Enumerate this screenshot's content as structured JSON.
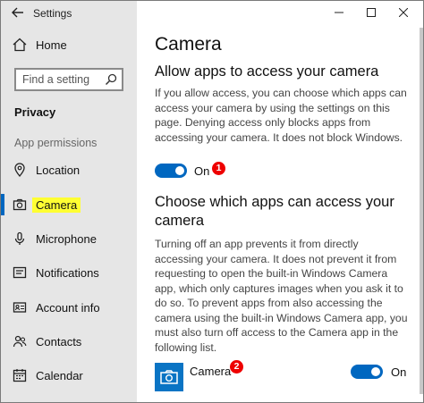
{
  "window": {
    "title": "Settings"
  },
  "sidebar": {
    "home": "Home",
    "search_placeholder": "Find a setting",
    "category": "Privacy",
    "section": "App permissions",
    "items": [
      {
        "label": "Location",
        "icon": "location-icon"
      },
      {
        "label": "Camera",
        "icon": "camera-icon",
        "selected": true
      },
      {
        "label": "Microphone",
        "icon": "microphone-icon"
      },
      {
        "label": "Notifications",
        "icon": "notifications-icon"
      },
      {
        "label": "Account info",
        "icon": "account-info-icon"
      },
      {
        "label": "Contacts",
        "icon": "contacts-icon"
      },
      {
        "label": "Calendar",
        "icon": "calendar-icon"
      }
    ]
  },
  "main": {
    "page_title": "Camera",
    "allow_heading": "Allow apps to access your camera",
    "allow_text": "If you allow access, you can choose which apps can access your camera by using the settings on this page. Denying access only blocks apps from accessing your camera. It does not block Windows.",
    "allow_toggle_state": "On",
    "badge1": "1",
    "choose_heading": "Choose which apps can access your camera",
    "choose_text": "Turning off an app prevents it from directly accessing your camera. It does not prevent it from requesting to open the built-in Windows Camera app, which only captures images when you ask it to do so. To prevent apps from also accessing the camera using the built-in Windows Camera app, you must also turn off access to the Camera app in the following list.",
    "app_name": "Camera",
    "badge2": "2",
    "app_toggle_state": "On"
  },
  "colors": {
    "accent": "#0067c0",
    "highlight": "#ffff33",
    "badge": "#e00000",
    "sidebar_bg": "#e6e6e6"
  }
}
